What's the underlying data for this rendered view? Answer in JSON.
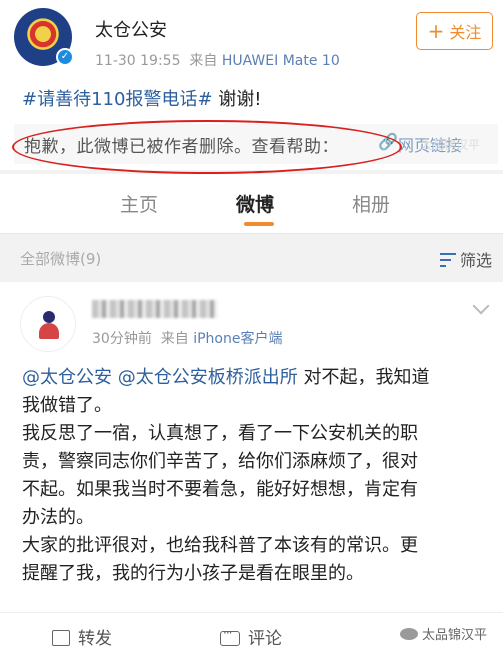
{
  "post": {
    "author": "太仓公安",
    "time": "11-30 19:55",
    "source_prefix": "来自",
    "device": "HUAWEI Mate 10",
    "follow_label": "关注",
    "hashtag": "#请善待110报警电话#",
    "text": " 谢谢!",
    "deleted_notice": "抱歉，此微博已被作者删除。查看帮助：",
    "deleted_link": "网页链接"
  },
  "tabs": [
    "主页",
    "微博",
    "相册"
  ],
  "filter": {
    "label": "全部微博(9)",
    "button": "筛选"
  },
  "repost": {
    "time": "30分钟前",
    "source_prefix": "来自",
    "device": "iPhone客户端",
    "mention1": "@太仓公安",
    "mention2": "@太仓公安板桥派出所",
    "line1_tail": " 对不起，我知道",
    "line2": "我做错了。",
    "line3": "我反思了一宿，认真想了，看了一下公安机关的职",
    "line4": "责，警察同志你们辛苦了，给你们添麻烦了，很对",
    "line5": "不起。如果我当时不要着急，能好好想想，肯定有",
    "line6": "办法的。",
    "line7": "大家的批评很对，也给我科普了本该有的常识。更",
    "line8": "提醒了我，我的行为小孩子是看在眼里的。"
  },
  "actions": {
    "repost": "转发",
    "comment": "评论"
  },
  "watermark": "太品锦汉平",
  "colors": {
    "accent": "#f08c2d",
    "link": "#2d5f9e",
    "highlight_circle": "#d8201e"
  }
}
